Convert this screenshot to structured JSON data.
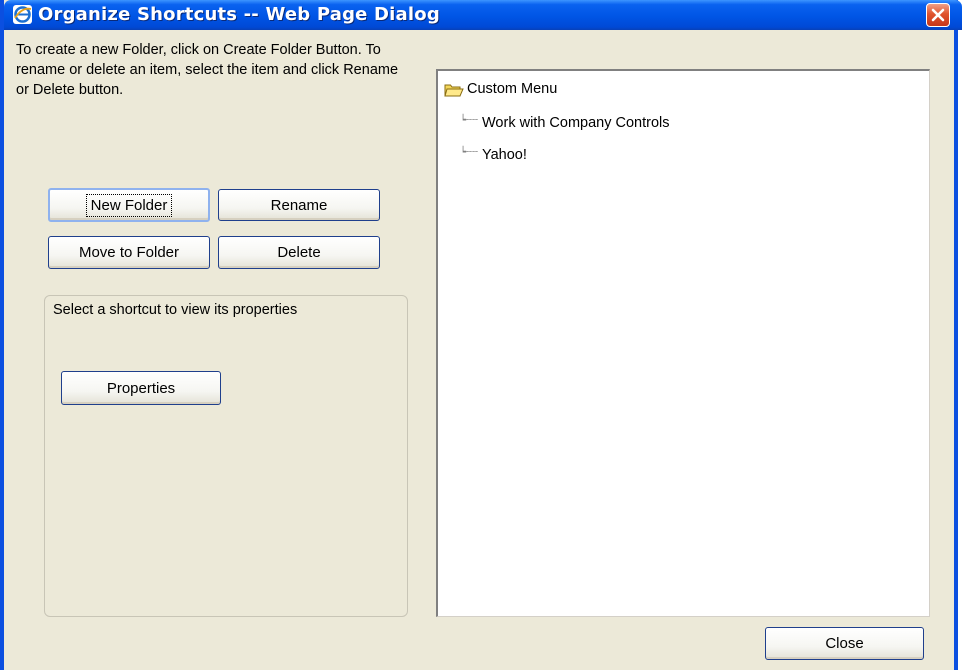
{
  "window": {
    "title": "Organize Shortcuts -- Web Page Dialog",
    "title_icon": "ie-icon",
    "close_icon": "close-icon"
  },
  "instructions": "To create a new Folder, click on Create Folder Button. To rename or delete an item, select the item and click Rename or Delete button.",
  "buttons": {
    "new_folder": "New Folder",
    "rename": "Rename",
    "move_to_folder": "Move to Folder",
    "delete": "Delete",
    "properties": "Properties",
    "close": "Close"
  },
  "properties_panel": {
    "label": "Select a shortcut to view its properties"
  },
  "tree": {
    "root": {
      "label": "Custom Menu",
      "icon": "folder-open-icon"
    },
    "children": [
      {
        "label": "Work with Company Controls"
      },
      {
        "label": "Yahoo!"
      }
    ]
  },
  "colors": {
    "titlebar": "#0055e5",
    "dialog_bg": "#ece9d8",
    "close_button": "#e0542e"
  }
}
